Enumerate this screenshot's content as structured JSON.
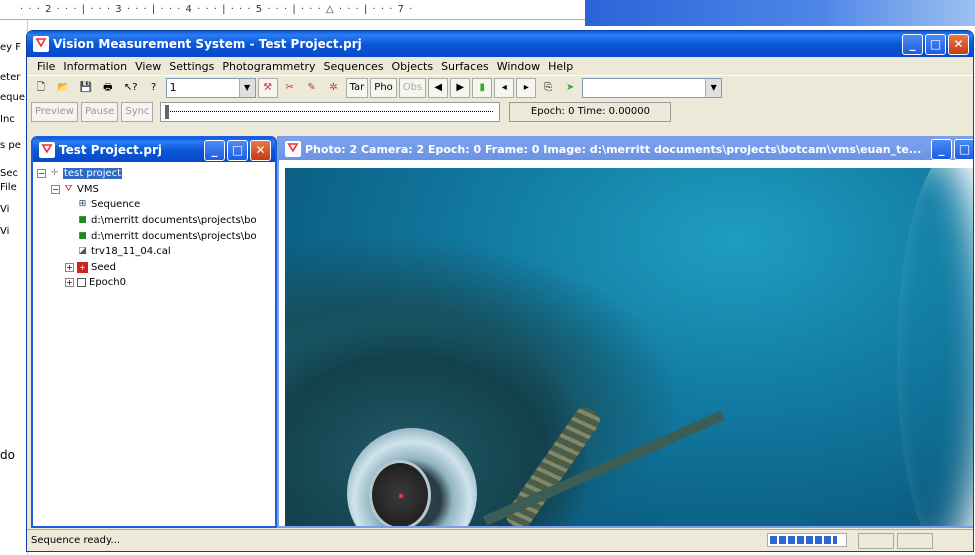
{
  "background_doc": {
    "ruler_text": "· · · 2 · · · | · · · 3 · · · | · · · 4 · · · | · · · 5 · · · | · · · △ · · · | · · · 7 ·",
    "left_fragments": [
      "ey F",
      "eter",
      "eque",
      "Inc",
      "s pe",
      "Sec",
      "File",
      "Vi",
      "Vi",
      "do"
    ]
  },
  "main_window": {
    "title": "Vision Measurement System - Test Project.prj",
    "menu": [
      "File",
      "Information",
      "View",
      "Settings",
      "Photogrammetry",
      "Sequences",
      "Objects",
      "Surfaces",
      "Window",
      "Help"
    ],
    "toolbar": {
      "combo1_value": "1",
      "tar_label": "Tar",
      "pho_label": "Pho",
      "obs_label": "Obs",
      "combo2_value": ""
    },
    "toolbar2": {
      "preview_label": "Preview",
      "pause_label": "Pause",
      "sync_label": "Sync",
      "epoch_readout": "Epoch: 0 Time: 0.00000"
    },
    "status_text": "Sequence ready...",
    "progress_fraction": 0.9
  },
  "project_window": {
    "title": "Test Project.prj",
    "tree": {
      "root": "test project",
      "vms": "VMS",
      "sequence": "Sequence",
      "file1": "d:\\merritt documents\\projects\\bo",
      "file2": "d:\\merritt documents\\projects\\bo",
      "cal": "trv18_11_04.cal",
      "seed": "Seed",
      "epoch": "Epoch0"
    }
  },
  "photo_window": {
    "title": "Photo: 2 Camera: 2 Epoch: 0  Frame: 0 Image: d:\\merritt documents\\projects\\botcam\\vms\\euan_te..."
  },
  "colors": {
    "title_blue": "#0b58d8",
    "water_teal": "#137ea5"
  }
}
